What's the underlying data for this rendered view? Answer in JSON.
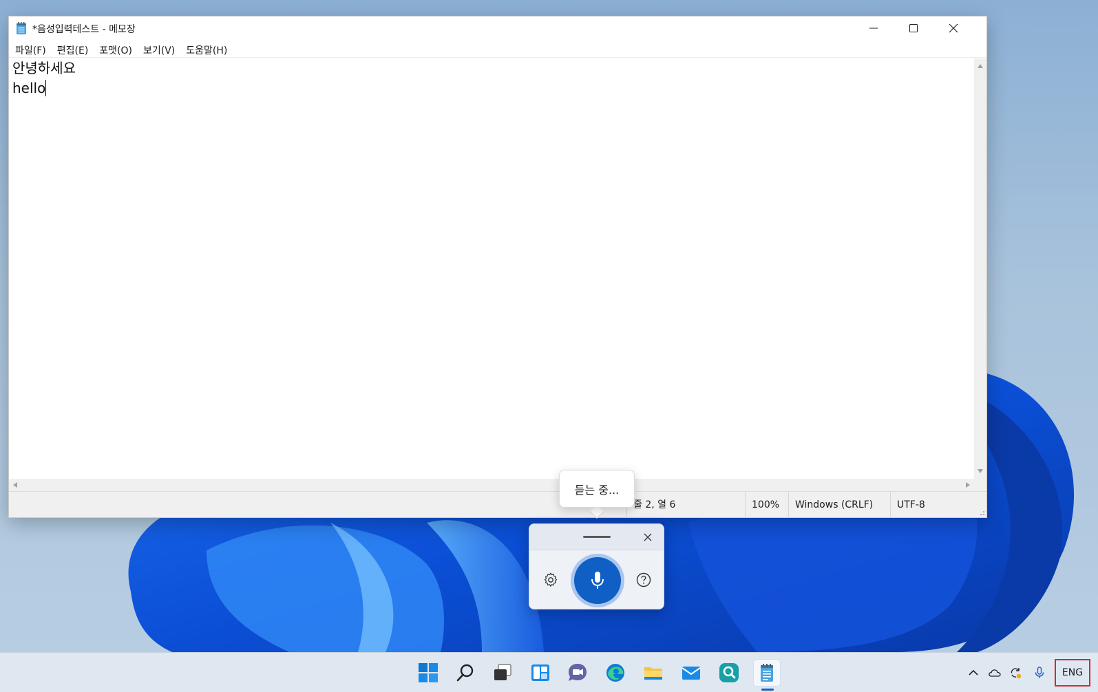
{
  "window": {
    "title": "*음성입력테스트 - 메모장"
  },
  "menu": [
    {
      "label": "파일(F)"
    },
    {
      "label": "편집(E)"
    },
    {
      "label": "포맷(O)"
    },
    {
      "label": "보기(V)"
    },
    {
      "label": "도움말(H)"
    }
  ],
  "editor": {
    "lines": [
      "안녕하세요",
      "hello"
    ]
  },
  "status": {
    "position": "줄 2, 열 6",
    "zoom": "100%",
    "line_ending": "Windows (CRLF)",
    "encoding": "UTF-8"
  },
  "voice_typing": {
    "status_text": "듣는 중...",
    "accent_color": "#0f5fc4"
  },
  "taskbar": {
    "apps": [
      "start",
      "search",
      "task-view",
      "widgets",
      "chat",
      "edge",
      "file-explorer",
      "mail",
      "search-app",
      "notepad"
    ],
    "language": "ENG",
    "language_highlight_color": "#e0242b"
  }
}
